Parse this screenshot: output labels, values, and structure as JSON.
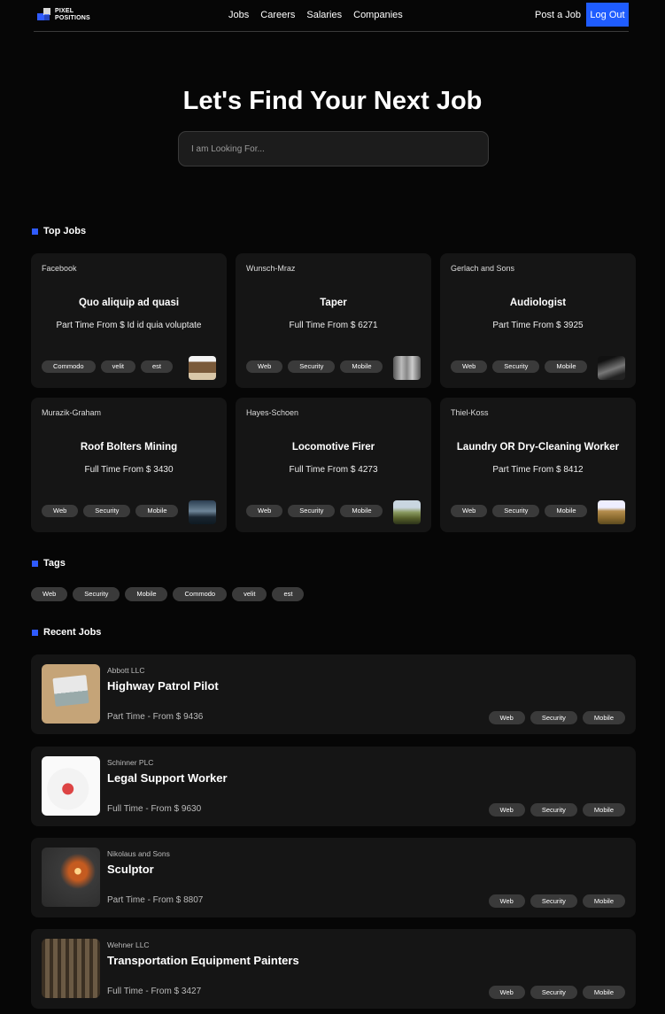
{
  "nav": {
    "logo_text": "PIXEL\nPOSITIONS",
    "links": [
      "Jobs",
      "Careers",
      "Salaries",
      "Companies"
    ],
    "post_job": "Post a Job",
    "logout": "Log Out"
  },
  "hero": {
    "title": "Let's Find Your Next Job",
    "search_placeholder": "I am Looking For..."
  },
  "top_jobs": {
    "heading": "Top Jobs",
    "cards": [
      {
        "employer": "Facebook",
        "title": "Quo aliquip ad quasi",
        "salary": "Part Time From $ Id id quia voluptate",
        "tags": [
          "Commodo",
          "velit",
          "est"
        ],
        "thumb": "museum-photo"
      },
      {
        "employer": "Wunsch-Mraz",
        "title": "Taper",
        "salary": "Full Time From $ 6271",
        "tags": [
          "Web",
          "Security",
          "Mobile"
        ],
        "thumb": "bridge-photo"
      },
      {
        "employer": "Gerlach and Sons",
        "title": "Audiologist",
        "salary": "Part Time From $ 3925",
        "tags": [
          "Web",
          "Security",
          "Mobile"
        ],
        "thumb": "dark-landscape-photo"
      },
      {
        "employer": "Murazik-Graham",
        "title": "Roof Bolters Mining",
        "salary": "Full Time From $ 3430",
        "tags": [
          "Web",
          "Security",
          "Mobile"
        ],
        "thumb": "storm-photo"
      },
      {
        "employer": "Hayes-Schoen",
        "title": "Locomotive Firer",
        "salary": "Full Time From $ 4273",
        "tags": [
          "Web",
          "Security",
          "Mobile"
        ],
        "thumb": "sunset-landscape-photo"
      },
      {
        "employer": "Thiel-Koss",
        "title": "Laundry OR Dry-Cleaning Worker",
        "salary": "Part Time From $ 8412",
        "tags": [
          "Web",
          "Security",
          "Mobile"
        ],
        "thumb": "wheat-field-photo"
      }
    ]
  },
  "tags_section": {
    "heading": "Tags",
    "tags": [
      "Web",
      "Security",
      "Mobile",
      "Commodo",
      "velit",
      "est"
    ]
  },
  "recent_jobs": {
    "heading": "Recent Jobs",
    "items": [
      {
        "employer": "Abbott LLC",
        "title": "Highway Patrol Pilot",
        "salary": "Part Time - From $ 9436",
        "tags": [
          "Web",
          "Security",
          "Mobile"
        ],
        "thumb": "laptop-photo"
      },
      {
        "employer": "Schinner PLC",
        "title": "Legal Support Worker",
        "salary": "Full Time - From $ 9630",
        "tags": [
          "Web",
          "Security",
          "Mobile"
        ],
        "thumb": "fruit-bowl-photo"
      },
      {
        "employer": "Nikolaus and Sons",
        "title": "Sculptor",
        "salary": "Part Time - From $ 8807",
        "tags": [
          "Web",
          "Security",
          "Mobile"
        ],
        "thumb": "sparkler-photo"
      },
      {
        "employer": "Wehner LLC",
        "title": "Transportation Equipment Painters",
        "salary": "Full Time - From $ 3427",
        "tags": [
          "Web",
          "Security",
          "Mobile"
        ],
        "thumb": "forest-photo"
      }
    ]
  },
  "colors": {
    "accent": "#1f5cff",
    "background": "#060606",
    "card": "#151515",
    "tag": "#3a3a3a"
  }
}
